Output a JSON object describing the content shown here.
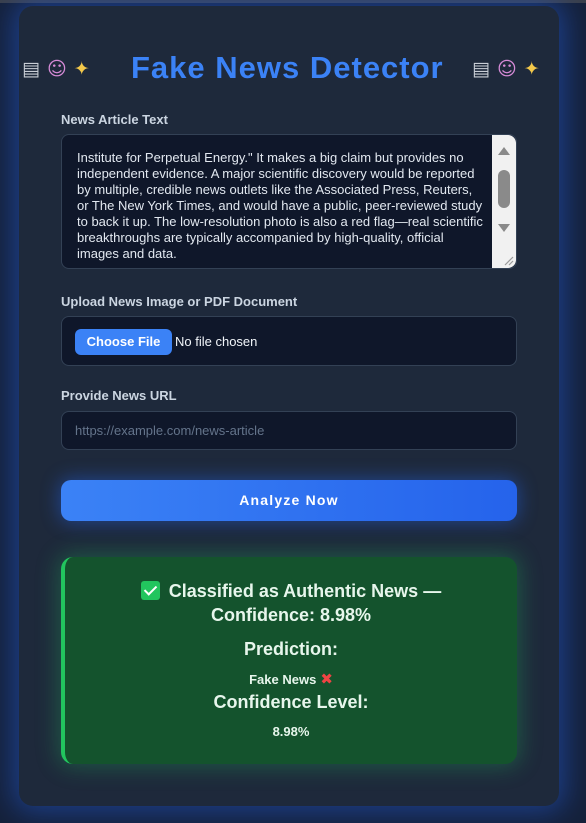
{
  "header": {
    "title": "Fake News Detector",
    "left_icons": [
      "newspaper-icon",
      "robot-icon",
      "sparkles-icon"
    ],
    "right_icons": [
      "newspaper-icon",
      "robot-icon",
      "sparkles-icon"
    ]
  },
  "form": {
    "article_label": "News Article Text",
    "article_text": "Institute for Perpetual Energy.\" It makes a big claim but provides no independent evidence. A major scientific discovery would be reported by multiple, credible news outlets like the Associated Press, Reuters, or The New York Times, and would have a public, peer-reviewed study to back it up. The low-resolution photo is also a red flag—real scientific breakthroughs are typically accompanied by high-quality, official images and data.",
    "upload_label": "Upload News Image or PDF Document",
    "choose_file_label": "Choose File",
    "file_status": "No file chosen",
    "url_label": "Provide News URL",
    "url_value": "",
    "url_placeholder": "https://example.com/news-article",
    "analyze_label": "Analyze Now"
  },
  "result": {
    "headline_line1": "Classified as Authentic News —",
    "headline_line2": "Confidence: 8.98%",
    "prediction_heading": "Prediction:",
    "prediction_value": "Fake News",
    "confidence_heading": "Confidence Level:",
    "confidence_value": "8.98%"
  },
  "colors": {
    "accent": "#3b82f6",
    "card_bg": "#1e293b",
    "result_bg": "#14532d",
    "result_border": "#22c55e",
    "fake_mark": "#ef4444"
  }
}
